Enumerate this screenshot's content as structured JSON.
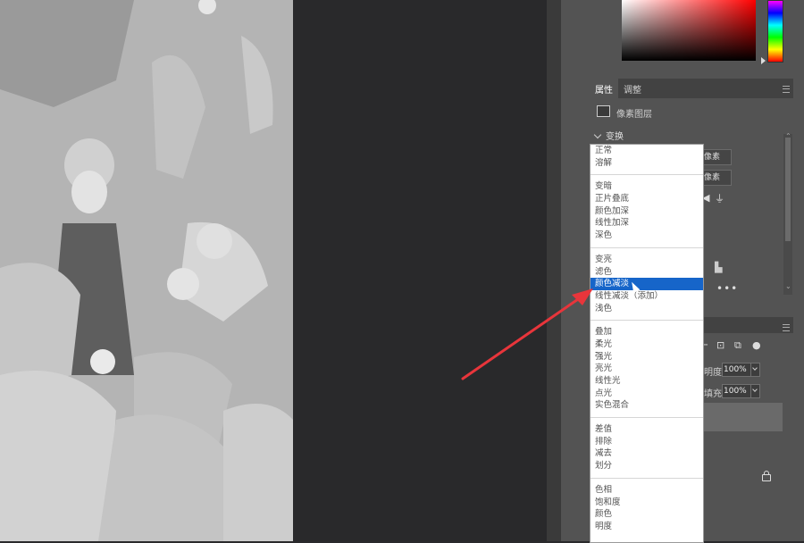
{
  "properties_panel": {
    "tabs": [
      {
        "label": "属性",
        "active": true
      },
      {
        "label": "调整",
        "active": false
      }
    ],
    "layer_kind": "像素图层",
    "transform_section": "变换",
    "width_unit": "像素",
    "height_unit": "像素"
  },
  "layers_panel": {
    "opacity_label": "明度:",
    "opacity_value": "100%",
    "fill_label": "填充:",
    "fill_value": "100%"
  },
  "blend_modes": {
    "groups": [
      [
        "正常",
        "溶解"
      ],
      [
        "变暗",
        "正片叠底",
        "颜色加深",
        "线性加深",
        "深色"
      ],
      [
        "变亮",
        "滤色",
        "颜色减淡",
        "线性减淡（添加）",
        "浅色"
      ],
      [
        "叠加",
        "柔光",
        "强光",
        "亮光",
        "线性光",
        "点光",
        "实色混合"
      ],
      [
        "差值",
        "排除",
        "减去",
        "划分"
      ],
      [
        "色相",
        "饱和度",
        "颜色",
        "明度"
      ]
    ],
    "highlighted": "颜色减淡"
  },
  "colors": {
    "highlight": "#1665c9",
    "arrow": "#e8353b",
    "panel_bg": "#535353",
    "pasteboard": "#29292b"
  }
}
